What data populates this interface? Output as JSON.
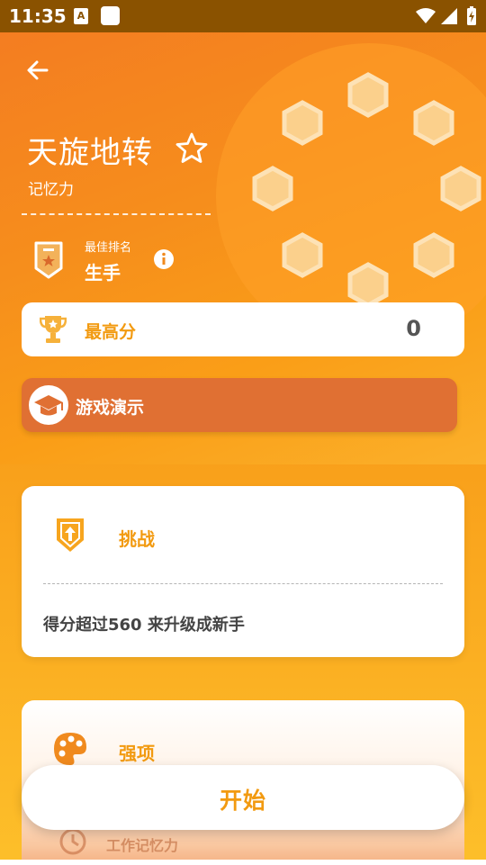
{
  "status_bar": {
    "time": "11:35",
    "a_badge": "A"
  },
  "header": {
    "title": "天旋地转",
    "subtitle": "记忆力",
    "rank_label": "最佳排名",
    "rank_value": "生手"
  },
  "score_card": {
    "label": "最高分",
    "value": "0"
  },
  "demo": {
    "label": "游戏演示"
  },
  "challenge": {
    "title": "挑战",
    "description": "得分超过560 来升级成新手"
  },
  "strength": {
    "title": "强项",
    "skill_label": "工作记忆力"
  },
  "start_button": {
    "label": "开始"
  },
  "colors": {
    "accent": "#f29a10",
    "demo_button": "#e07033",
    "status_bar": "#8a5200"
  }
}
